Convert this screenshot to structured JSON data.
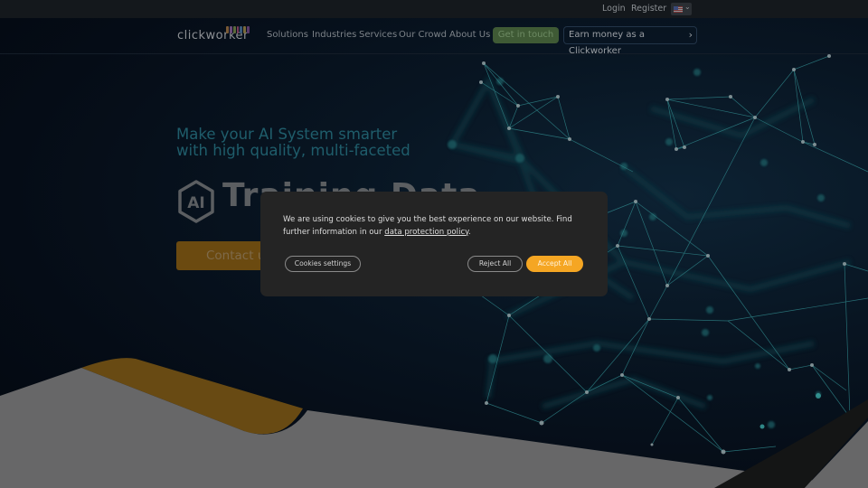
{
  "topbar": {
    "login_label": "Login",
    "register_label": "Register",
    "language": {
      "icon": "us-flag-icon",
      "dropdown_icon": "chevron-down-icon"
    }
  },
  "nav": {
    "logo_text": "clickworker",
    "items": [
      {
        "label": "Solutions"
      },
      {
        "label": "Industries"
      },
      {
        "label": "Services"
      },
      {
        "label": "Our Crowd"
      },
      {
        "label": "About Us"
      }
    ],
    "get_in_touch_label": "Get in touch",
    "earn_money_label": "Earn money as a Clickworker",
    "earn_money_icon": "chevron-right-icon"
  },
  "hero": {
    "subtitle_line1": "Make your AI System smarter",
    "subtitle_line2": "with high quality, multi-faceted",
    "badge_text": "AI",
    "title": "Training Data",
    "contact_label": "Contact us"
  },
  "cookie_banner": {
    "text_before_link": "We are using cookies to give you the best experience on our website. Find further information in our ",
    "link_text": "data protection policy",
    "text_after_link": ".",
    "settings_label": "Cookies settings",
    "reject_label": "Reject All",
    "accept_label": "Accept All"
  },
  "colors": {
    "accent_orange": "#f5a623",
    "accent_green": "#3f5a35",
    "teal_text": "#1f5d6b",
    "cookie_bg": "#242424",
    "gold_shape": "#684a13",
    "gray_shape": "#676768"
  }
}
